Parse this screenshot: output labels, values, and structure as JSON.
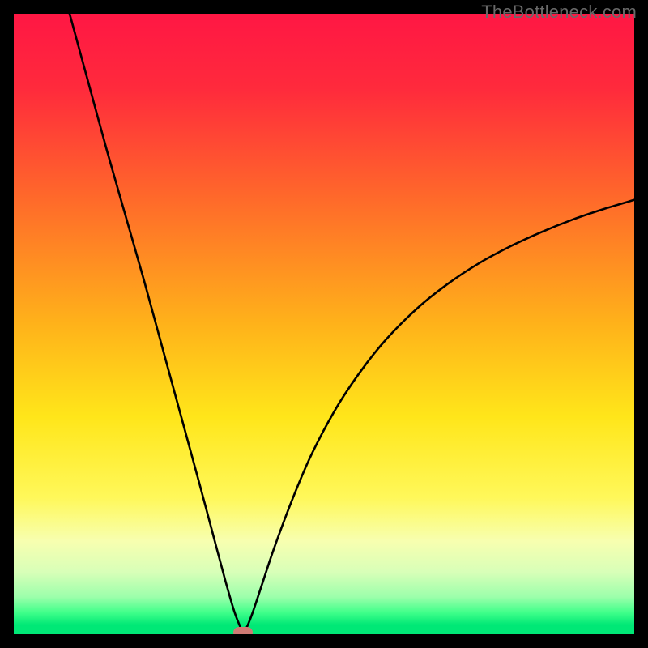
{
  "watermark": "TheBottleneck.com",
  "chart_data": {
    "type": "line",
    "title": "",
    "xlabel": "",
    "ylabel": "",
    "xlim": [
      0,
      100
    ],
    "ylim": [
      0,
      100
    ],
    "series": [
      {
        "name": "curve",
        "x": [
          9,
          12,
          15,
          18,
          21,
          24,
          27,
          30,
          32,
          34,
          35.5,
          36.5,
          37,
          37.5,
          38.5,
          40,
          42,
          45,
          48,
          52,
          56,
          60,
          65,
          70,
          75,
          80,
          85,
          90,
          95,
          100
        ],
        "y": [
          100,
          89,
          78,
          67.5,
          57,
          46,
          35,
          24,
          16.5,
          9,
          3.8,
          1.2,
          0.3,
          1.0,
          3.5,
          8,
          14,
          22,
          29,
          36.5,
          42.5,
          47.5,
          52.5,
          56.5,
          59.8,
          62.5,
          64.8,
          66.8,
          68.5,
          70
        ]
      }
    ],
    "marker": {
      "x": 37,
      "y": 0.3
    },
    "gradient_stops": [
      {
        "offset": 0.0,
        "color": "#ff1744"
      },
      {
        "offset": 0.12,
        "color": "#ff2a3c"
      },
      {
        "offset": 0.3,
        "color": "#ff6a2a"
      },
      {
        "offset": 0.5,
        "color": "#ffb21a"
      },
      {
        "offset": 0.65,
        "color": "#ffe61a"
      },
      {
        "offset": 0.78,
        "color": "#fff85a"
      },
      {
        "offset": 0.85,
        "color": "#f7ffb0"
      },
      {
        "offset": 0.9,
        "color": "#d8ffb8"
      },
      {
        "offset": 0.94,
        "color": "#9cffab"
      },
      {
        "offset": 0.965,
        "color": "#40ff8a"
      },
      {
        "offset": 0.985,
        "color": "#00e876"
      },
      {
        "offset": 1.0,
        "color": "#00e876"
      }
    ]
  }
}
